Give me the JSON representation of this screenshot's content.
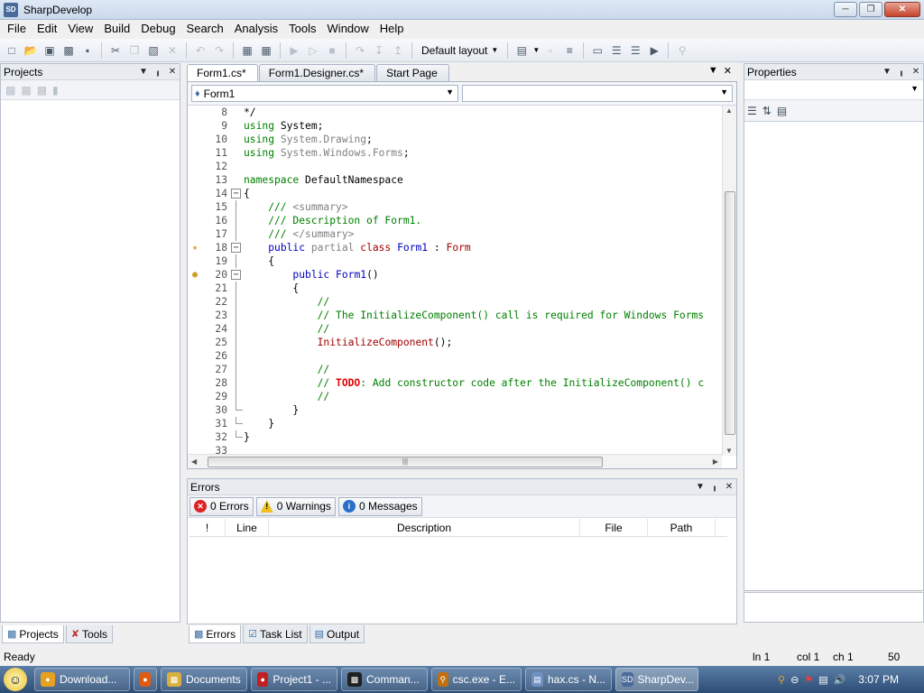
{
  "window": {
    "title": "SharpDevelop",
    "app_icon": "SD"
  },
  "menu": [
    "File",
    "Edit",
    "View",
    "Build",
    "Debug",
    "Search",
    "Analysis",
    "Tools",
    "Window",
    "Help"
  ],
  "toolbar": {
    "layout_label": "Default layout"
  },
  "projects_panel": {
    "title": "Projects"
  },
  "left_tabs": [
    {
      "label": "Projects"
    },
    {
      "label": "Tools"
    }
  ],
  "doc_tabs": [
    "Form1.cs*",
    "Form1.Designer.cs*",
    "Start Page"
  ],
  "editor": {
    "class_combo": "Form1",
    "member_combo": "",
    "lines": [
      {
        "n": "8",
        "text": "*/"
      },
      {
        "n": "9",
        "text": "using System;"
      },
      {
        "n": "10",
        "text": "using System.Drawing;"
      },
      {
        "n": "11",
        "text": "using System.Windows.Forms;"
      },
      {
        "n": "12",
        "text": ""
      },
      {
        "n": "13",
        "text": "namespace DefaultNamespace"
      },
      {
        "n": "14",
        "text": "{"
      },
      {
        "n": "15",
        "text": "    /// <summary>"
      },
      {
        "n": "16",
        "text": "    /// Description of Form1."
      },
      {
        "n": "17",
        "text": "    /// </summary>"
      },
      {
        "n": "18",
        "text": "    public partial class Form1 : Form"
      },
      {
        "n": "19",
        "text": "    {"
      },
      {
        "n": "20",
        "text": "        public Form1()"
      },
      {
        "n": "21",
        "text": "        {"
      },
      {
        "n": "22",
        "text": "            //"
      },
      {
        "n": "23",
        "text": "            // The InitializeComponent() call is required for Windows Forms"
      },
      {
        "n": "24",
        "text": "            //"
      },
      {
        "n": "25",
        "text": "            InitializeComponent();"
      },
      {
        "n": "26",
        "text": ""
      },
      {
        "n": "27",
        "text": "            //"
      },
      {
        "n": "28",
        "text": "            // TODO: Add constructor code after the InitializeComponent() c"
      },
      {
        "n": "29",
        "text": "            //"
      },
      {
        "n": "30",
        "text": "        }"
      },
      {
        "n": "31",
        "text": "    }"
      },
      {
        "n": "32",
        "text": "}"
      },
      {
        "n": "33",
        "text": ""
      }
    ]
  },
  "errors_panel": {
    "title": "Errors",
    "errors_btn": "0 Errors",
    "warnings_btn": "0 Warnings",
    "messages_btn": "0 Messages",
    "columns": [
      "!",
      "Line",
      "Description",
      "File",
      "Path"
    ]
  },
  "bottom_tabs": [
    {
      "label": "Errors"
    },
    {
      "label": "Task List"
    },
    {
      "label": "Output"
    }
  ],
  "properties_panel": {
    "title": "Properties"
  },
  "status": {
    "text": "Ready",
    "ln": "ln 1",
    "col": "col 1",
    "ch": "ch 1",
    "num": "50"
  },
  "taskbar": {
    "items": [
      {
        "label": "Download...",
        "color": "#e8a020"
      },
      {
        "label": "",
        "color": "#e05a10"
      },
      {
        "label": "Documents",
        "color": "#d8b040"
      },
      {
        "label": "Project1 - ...",
        "color": "#c02020"
      },
      {
        "label": "Comman...",
        "color": "#202020"
      },
      {
        "label": "csc.exe - E...",
        "color": "#c07010"
      },
      {
        "label": "hax.cs - N...",
        "color": "#7090c0"
      },
      {
        "label": "SharpDev...",
        "color": "#4a6b9a"
      }
    ],
    "clock": "3:07 PM"
  }
}
